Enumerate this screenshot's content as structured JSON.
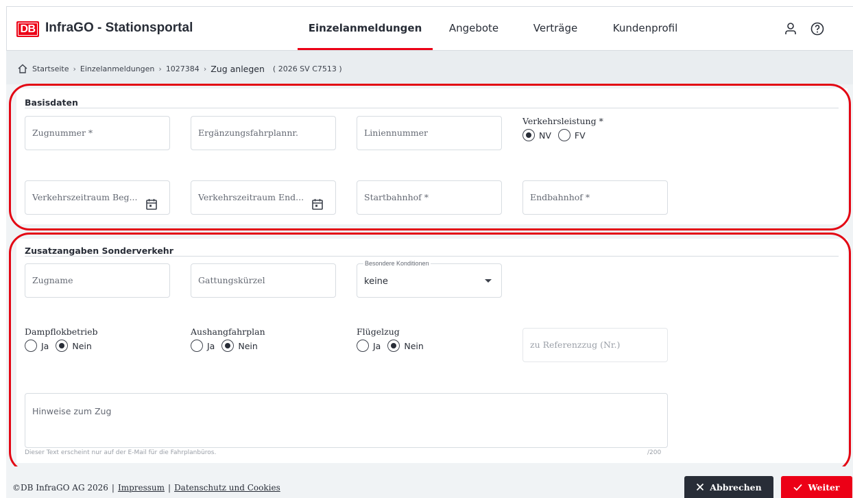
{
  "header": {
    "logo_text": "DB",
    "app_title": "InfraGO - Stationsportal",
    "nav": [
      {
        "label": "Einzelanmeldungen",
        "active": true
      },
      {
        "label": "Angebote",
        "active": false
      },
      {
        "label": "Verträge",
        "active": false
      },
      {
        "label": "Kundenprofil",
        "active": false
      }
    ],
    "icons": {
      "profile": "user-icon",
      "help": "help-icon"
    }
  },
  "breadcrumb": {
    "home_icon": "home-icon",
    "items": [
      "Startseite",
      "Einzelanmeldungen",
      "1027384"
    ],
    "current": "Zug anlegen",
    "reference": "( 2026 SV C7513 )"
  },
  "basisdaten": {
    "title": "Basisdaten",
    "zugnummer": "Zugnummer *",
    "ergaenzung": "Ergänzungsfahrplannr.",
    "liniennummer": "Liniennummer",
    "verkehrsleistung_label": "Verkehrsleistung *",
    "verkehrsleistung_options": [
      "NV",
      "FV"
    ],
    "verkehrsleistung_selected": "NV",
    "zeitraum_beginn": "Verkehrszeitraum Beg...",
    "zeitraum_ende": "Verkehrszeitraum End...",
    "startbahnhof": "Startbahnhof *",
    "endbahnhof": "Endbahnhof *"
  },
  "zusatz": {
    "title": "Zusatzangaben Sonderverkehr",
    "zugname": "Zugname",
    "gattung": "Gattungskürzel",
    "konditionen_label": "Besondere Konditionen",
    "konditionen_value": "keine",
    "dampflok_label": "Dampflokbetrieb",
    "aushang_label": "Aushangfahrplan",
    "fluegel_label": "Flügelzug",
    "ja": "Ja",
    "nein": "Nein",
    "dampflok_selected": "Nein",
    "aushang_selected": "Nein",
    "fluegel_selected": "Nein",
    "referenzzug": "zu Referenzzug (Nr.)",
    "hinweise": "Hinweise zum Zug",
    "hinweise_hint": "Dieser Text erscheint nur auf der E-Mail für die Fahrplanbüros.",
    "counter": "/200"
  },
  "footer": {
    "copyright": "©DB InfraGO AG 2026",
    "impressum": "Impressum",
    "datenschutz": "Datenschutz und Cookies",
    "cancel_label": "Abbrechen",
    "next_label": "Weiter"
  },
  "colors": {
    "brand_red": "#ec0016",
    "dark": "#282d37",
    "annotation_red": "#e30613"
  }
}
